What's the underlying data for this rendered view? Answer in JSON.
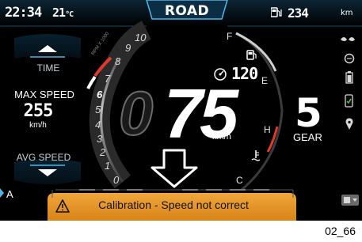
{
  "topbar": {
    "time": "22:34",
    "temperature": "21°C",
    "temp_value": "21",
    "temp_unit": "°C",
    "mode": "ROAD",
    "range": "234",
    "range_unit": "km",
    "icons": [
      "fuel-range-icon"
    ]
  },
  "left_panel": {
    "time_label": "TIME",
    "max_speed_label": "MAX SPEED",
    "max_speed_value": "255",
    "max_speed_unit": "km/h",
    "avg_speed_label": "AVG SPEED",
    "side_label": "A"
  },
  "gauge": {
    "rpm_scale_label": "RPM X 1000",
    "rpm_ticks": [
      "0",
      "1",
      "2",
      "3",
      "4",
      "5",
      "6",
      "7",
      "8",
      "9",
      "10"
    ],
    "fuel_full": "F",
    "fuel_empty": "E",
    "temp_hot": "H",
    "temp_cold": "C"
  },
  "center": {
    "speed": "75",
    "speed_ghost_digit": "0",
    "speed_unit": "km/h",
    "speed_limit_value": "120"
  },
  "gear": {
    "value": "5",
    "label": "GEAR"
  },
  "right_icons": [
    "connectivity-icon",
    "chat-icon",
    "battery-icon",
    "phone-icon",
    "location-icon",
    "menu-icon"
  ],
  "alert": {
    "message": "Calibration - Speed not correct",
    "icon": "warning-icon"
  },
  "caption": "02_66",
  "colors": {
    "accent_blue": "#4fb6e8",
    "alert_orange": "#e89a2c",
    "redline": "#e03a2a",
    "background": "#000000"
  }
}
